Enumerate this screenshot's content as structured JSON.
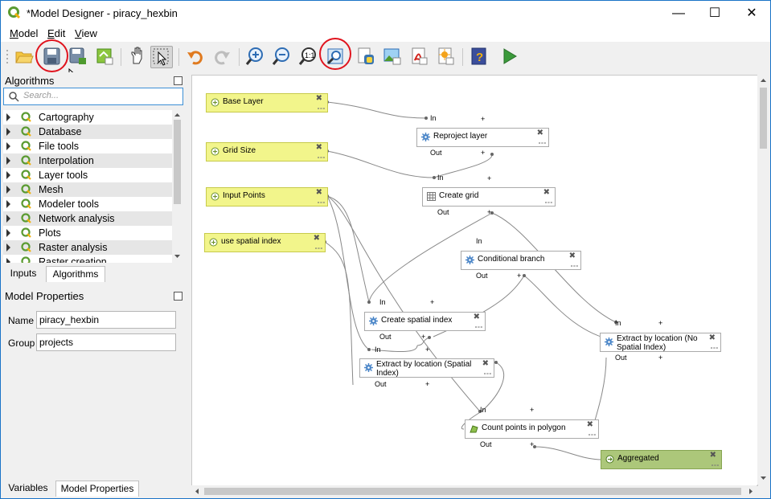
{
  "window": {
    "title": "*Model Designer - piracy_hexbin",
    "minimize": "—",
    "maximize": "☐",
    "close": "✕"
  },
  "menu": [
    {
      "label": "Model",
      "accel": "M",
      "rest": "odel"
    },
    {
      "label": "Edit",
      "accel": "E",
      "rest": "dit"
    },
    {
      "label": "View",
      "accel": "V",
      "rest": "iew"
    }
  ],
  "toolbar": {
    "icons": [
      "open-model-icon",
      "save-model-icon",
      "save-as-icon",
      "save-to-project-icon",
      "pan-icon",
      "select-icon",
      "undo-icon",
      "redo-icon",
      "zoom-in-icon",
      "zoom-out-icon",
      "zoom-actual-icon",
      "zoom-full-icon",
      "export-python-icon",
      "export-image-icon",
      "export-pdf-icon",
      "export-svg-icon",
      "help-icon",
      "run-model-icon"
    ],
    "highlight_color": "#e0141e"
  },
  "algorithms_panel": {
    "title": "Algorithms",
    "search_placeholder": "Search...",
    "items": [
      "Cartography",
      "Database",
      "File tools",
      "Interpolation",
      "Layer tools",
      "Mesh",
      "Modeler tools",
      "Network analysis",
      "Plots",
      "Raster analysis",
      "Raster creation"
    ]
  },
  "panel_tabs": {
    "inputs": "Inputs",
    "algorithms": "Algorithms"
  },
  "model_properties": {
    "title": "Model Properties",
    "name_label": "Name",
    "name_value": "piracy_hexbin",
    "group_label": "Group",
    "group_value": "projects"
  },
  "bottom_tabs": {
    "variables": "Variables",
    "model_properties": "Model Properties"
  },
  "canvas": {
    "inputs": {
      "base_layer": "Base Layer",
      "grid_size": "Grid Size",
      "input_points": "Input Points",
      "use_spatial_index": "use spatial index"
    },
    "algorithms": {
      "reproject": "Reproject layer",
      "create_grid": "Create grid",
      "conditional": "Conditional branch",
      "create_index": "Create spatial index",
      "extract_index": "Extract by location (Spatial Index)",
      "extract_no_index": "Extract by location (No Spatial Index)",
      "count_points": "Count points in polygon"
    },
    "outputs": {
      "aggregated": "Aggregated"
    },
    "port_in": "In",
    "port_out": "Out",
    "plus": "+",
    "close_glyph": "✖",
    "dots": "∘∘∘",
    "input_color": "#f2f58b",
    "output_color": "#acc77a"
  }
}
